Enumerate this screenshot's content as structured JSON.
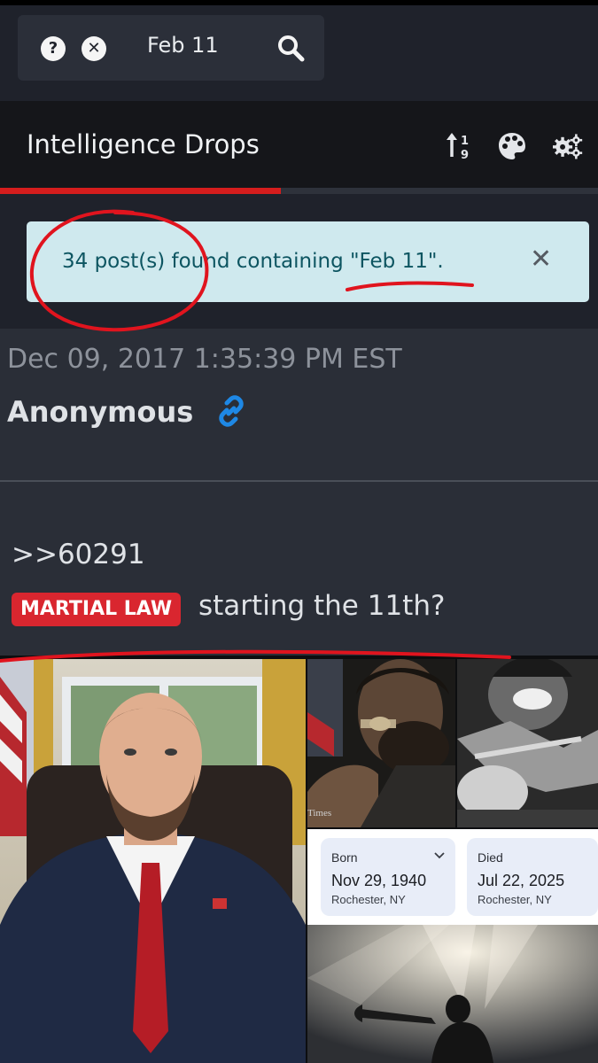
{
  "search": {
    "query": "Feb 11",
    "help_glyph": "?",
    "clear_glyph": "✕"
  },
  "header": {
    "title": "Intelligence Drops",
    "icons": [
      "sort-numeric-icon",
      "palette-icon",
      "gears-icon"
    ]
  },
  "results": {
    "progress": 0.47,
    "message": "34 post(s) found containing \"Feb 11\".",
    "close_glyph": "✕"
  },
  "post": {
    "timestamp": "Dec 09, 2017 1:35:39 PM EST",
    "author": "Anonymous",
    "reply_ref": ">>60291",
    "tag": "MARTIAL LAW",
    "text": "starting the 11th?"
  },
  "images": {
    "watermark": "Times",
    "born_label": "Born",
    "born_date": "Nov 29, 1940",
    "born_place": "Rochester, NY",
    "died_label": "Died",
    "died_date": "Jul 22, 2025",
    "died_place": "Rochester, NY"
  },
  "colors": {
    "accent": "#d51d1d",
    "alert_bg": "#cfe9ee",
    "alert_text": "#0d5561",
    "tag_bg": "#d9262f",
    "link_blue": "#1e88e5",
    "annotation_red": "#e0141e"
  }
}
